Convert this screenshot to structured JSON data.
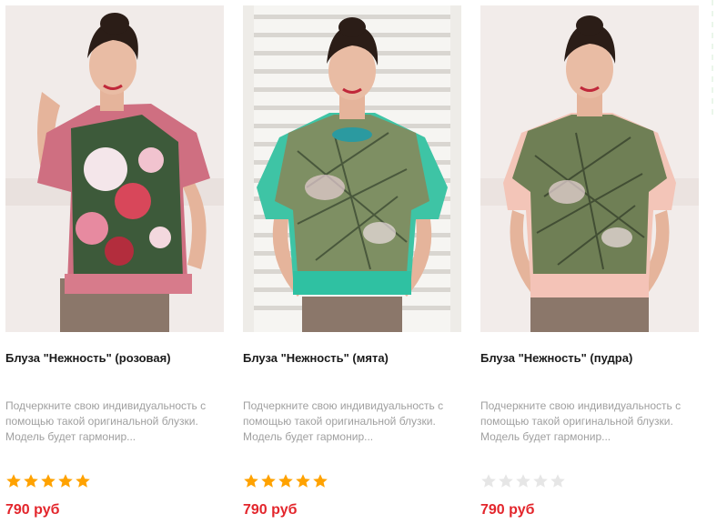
{
  "colors": {
    "price": "#e3262c",
    "star_filled": "#ffa200",
    "star_empty": "#e6e6e6",
    "title": "#1a1a1a",
    "description": "#a0a0a0"
  },
  "products": [
    {
      "title": "Блуза \"Нежность\" (розовая)",
      "description": "Подчеркните свою индивидуальность с помощью такой оригинальной блузки. Модель будет гармонир...",
      "rating": 5,
      "rating_max": 5,
      "price": "790 руб",
      "image_icon": "product-photo-pink-blouse"
    },
    {
      "title": "Блуза \"Нежность\" (мята)",
      "description": "Подчеркните свою индивидуальность с помощью такой оригинальной блузки. Модель будет гармонир...",
      "rating": 5,
      "rating_max": 5,
      "price": "790 руб",
      "image_icon": "product-photo-mint-blouse"
    },
    {
      "title": "Блуза \"Нежность\" (пудра)",
      "description": "Подчеркните свою индивидуальность с помощью такой оригинальной блузки. Модель будет гармонир...",
      "rating": 0,
      "rating_max": 5,
      "price": "790 руб",
      "image_icon": "product-photo-powder-blouse"
    }
  ]
}
